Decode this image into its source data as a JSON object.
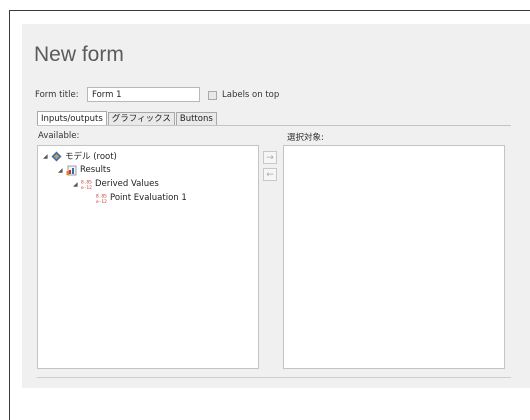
{
  "form": {
    "title": "New form",
    "form_title_label": "Form title:",
    "form_title_value": "Form 1",
    "labels_on_top_label": "Labels on top"
  },
  "tabs": [
    {
      "label": "Inputs/outputs",
      "active": true
    },
    {
      "label": "グラフィックス",
      "active": false
    },
    {
      "label": "Buttons",
      "active": false
    }
  ],
  "available_label": "Available:",
  "selected_label": "選択対象:",
  "tree": [
    {
      "label": "モデル (root)",
      "icon": "model-icon"
    },
    {
      "label": "Results",
      "icon": "results-icon"
    },
    {
      "label": "Derived Values",
      "icon": "derived-values-icon"
    },
    {
      "label": "Point Evaluation 1",
      "icon": "point-evaluation-icon"
    }
  ],
  "buttons": {
    "add": "→",
    "remove": "←"
  },
  "colors": {
    "panel_bg": "#f0f0f0",
    "accent_blue": "#2f6fb5",
    "accent_red": "#c0392b"
  }
}
